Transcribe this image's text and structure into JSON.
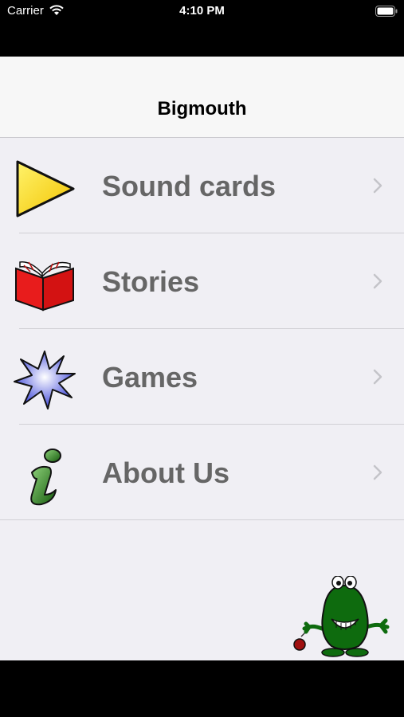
{
  "status_bar": {
    "carrier": "Carrier",
    "time": "4:10 PM",
    "wifi_icon": "wifi-icon",
    "battery_icon": "battery-icon"
  },
  "nav": {
    "title": "Bigmouth"
  },
  "menu": {
    "items": [
      {
        "label": "Sound cards",
        "icon": "play-triangle-icon"
      },
      {
        "label": "Stories",
        "icon": "open-book-icon"
      },
      {
        "label": "Games",
        "icon": "starburst-icon"
      },
      {
        "label": "About Us",
        "icon": "info-i-icon"
      }
    ],
    "chevron_icon": "chevron-right-icon"
  },
  "mascot": {
    "icon": "green-monster-mascot-icon"
  },
  "colors": {
    "background": "#f0eff4",
    "nav_background": "#f7f7f7",
    "label_text": "#666666",
    "chevron": "#c4c4c9",
    "play_yellow": "#ffe600",
    "book_red": "#e81c1c",
    "star_blue": "#2b35d6",
    "info_green": "#1e6b13",
    "mascot_green": "#0e6b0e"
  }
}
